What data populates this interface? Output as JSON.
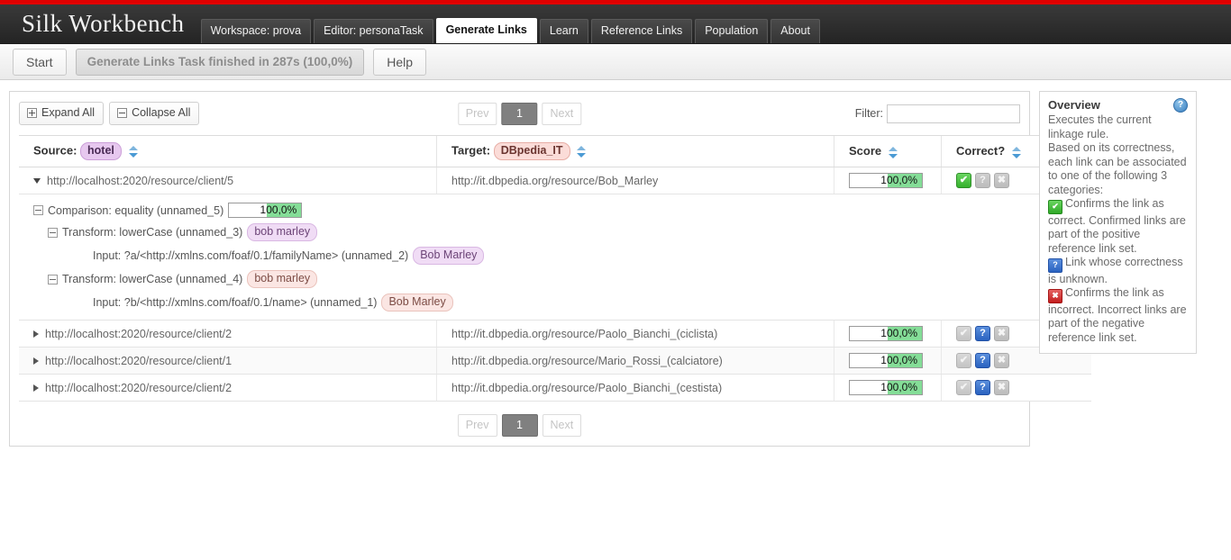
{
  "app": {
    "title": "Silk Workbench",
    "nav": [
      {
        "label": "Workspace: prova",
        "active": false
      },
      {
        "label": "Editor: personaTask",
        "active": false
      },
      {
        "label": "Generate Links",
        "active": true
      },
      {
        "label": "Learn",
        "active": false
      },
      {
        "label": "Reference Links",
        "active": false
      },
      {
        "label": "Population",
        "active": false
      },
      {
        "label": "About",
        "active": false
      }
    ]
  },
  "toolbar": {
    "start_label": "Start",
    "status_label": "Generate Links Task finished in 287s (100,0%)",
    "help_label": "Help"
  },
  "table_tools": {
    "expand_all": "Expand All",
    "collapse_all": "Collapse All",
    "filter_label": "Filter:",
    "filter_value": "",
    "filter_placeholder": ""
  },
  "pager": {
    "prev": "Prev",
    "current": "1",
    "next": "Next"
  },
  "columns": {
    "source_label": "Source:",
    "source_badge": "hotel",
    "target_label": "Target:",
    "target_badge": "DBpedia_IT",
    "score_label": "Score",
    "correct_label": "Correct?"
  },
  "rows": [
    {
      "source": "http://localhost:2020/resource/client/5",
      "target": "http://it.dbpedia.org/resource/Bob_Marley",
      "score_int": "100,",
      "score_dec": "0%",
      "expanded": true,
      "correct_state": "confirmed"
    },
    {
      "source": "http://localhost:2020/resource/client/2",
      "target": "http://it.dbpedia.org/resource/Paolo_Bianchi_(ciclista)",
      "score_int": "100,",
      "score_dec": "0%",
      "expanded": false,
      "correct_state": "unknown"
    },
    {
      "source": "http://localhost:2020/resource/client/1",
      "target": "http://it.dbpedia.org/resource/Mario_Rossi_(calciatore)",
      "score_int": "100,",
      "score_dec": "0%",
      "expanded": false,
      "correct_state": "unknown"
    },
    {
      "source": "http://localhost:2020/resource/client/2",
      "target": "http://it.dbpedia.org/resource/Paolo_Bianchi_(cestista)",
      "score_int": "100,",
      "score_dec": "0%",
      "expanded": false,
      "correct_state": "unknown"
    }
  ],
  "detail": {
    "comparison_label": "Comparison: equality (unnamed_5)",
    "comparison_score_int": "100,",
    "comparison_score_dec": "0%",
    "transform_a_label": "Transform: lowerCase (unnamed_3)",
    "transform_a_value": "bob marley",
    "input_a_label": "Input: ?a/<http://xmlns.com/foaf/0.1/familyName> (unnamed_2)",
    "input_a_value": "Bob Marley",
    "transform_b_label": "Transform: lowerCase (unnamed_4)",
    "transform_b_value": "bob marley",
    "input_b_label": "Input: ?b/<http://xmlns.com/foaf/0.1/name> (unnamed_1)",
    "input_b_value": "Bob Marley"
  },
  "overview": {
    "title": "Overview",
    "line1": "Executes the current linkage rule.",
    "line2": "Based on its correctness, each link can be associated to one of the following 3 categories:",
    "item_correct": "Confirms the link as correct. Confirmed links are part of the positive reference link set.",
    "item_unknown": "Link whose correctness is unknown.",
    "item_incorrect": "Confirms the link as incorrect. Incorrect links are part of the negative reference link set.",
    "help_glyph": "?"
  },
  "icons": {
    "check": "✔",
    "question": "?",
    "cross": "✖"
  },
  "colors": {
    "accent_red": "#e00000",
    "score_green": "#84dd97",
    "confirm_green": "#35b02c",
    "unknown_blue": "#2a62c0",
    "incorrect_red": "#c21d1d"
  }
}
